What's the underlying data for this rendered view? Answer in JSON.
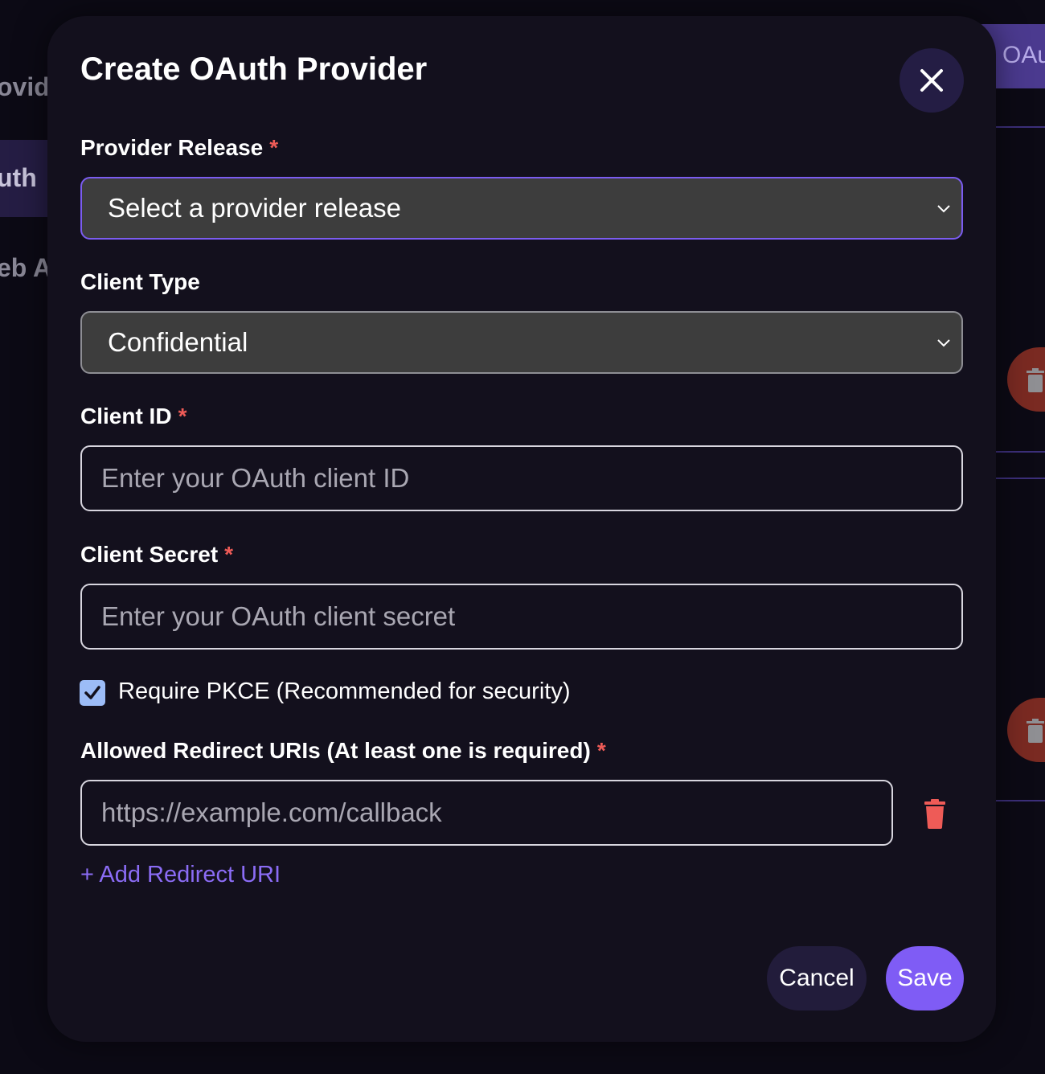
{
  "background": {
    "sidebar_fragments": [
      "ovide",
      "uth",
      "eb A"
    ],
    "header_button_fragment": "l OAu"
  },
  "modal": {
    "title": "Create OAuth Provider",
    "close_icon": "close-icon",
    "provider_release": {
      "label": "Provider Release",
      "required_marker": "*",
      "selected_value": "Select a provider release"
    },
    "client_type": {
      "label": "Client Type",
      "selected_value": "Confidential"
    },
    "client_id": {
      "label": "Client ID",
      "required_marker": "*",
      "value": "",
      "placeholder": "Enter your OAuth client ID"
    },
    "client_secret": {
      "label": "Client Secret",
      "required_marker": "*",
      "value": "",
      "placeholder": "Enter your OAuth client secret"
    },
    "pkce": {
      "label": "Require PKCE (Recommended for security)",
      "checked": true
    },
    "redirect_uris": {
      "label": "Allowed Redirect URIs (At least one is required)",
      "required_marker": "*",
      "entries": [
        {
          "value": "",
          "placeholder": "https://example.com/callback"
        }
      ],
      "add_label": "+ Add Redirect URI"
    },
    "actions": {
      "cancel_label": "Cancel",
      "save_label": "Save"
    }
  },
  "colors": {
    "accent": "#7f5cf5",
    "required": "#ee5b57",
    "danger": "#ee5b57",
    "modal_bg": "#13101d"
  }
}
